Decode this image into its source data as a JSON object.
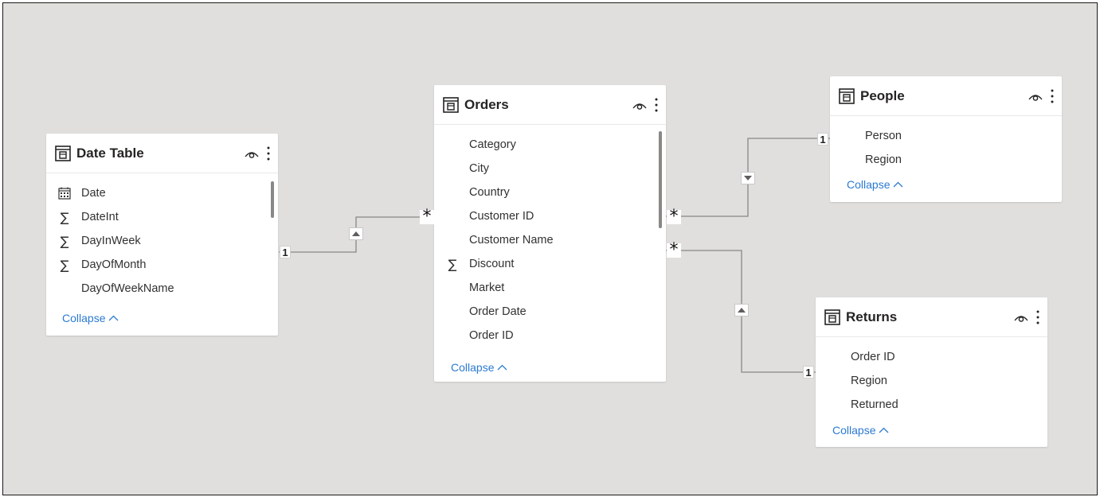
{
  "tables": {
    "date_table": {
      "title": "Date Table",
      "fields": [
        {
          "name": "Date",
          "icon": "calendar-icon"
        },
        {
          "name": "DateInt",
          "icon": "sigma-icon"
        },
        {
          "name": "DayInWeek",
          "icon": "sigma-icon"
        },
        {
          "name": "DayOfMonth",
          "icon": "sigma-icon"
        },
        {
          "name": "DayOfWeekName",
          "icon": ""
        }
      ],
      "collapse_label": "Collapse"
    },
    "orders": {
      "title": "Orders",
      "fields": [
        {
          "name": "Category",
          "icon": ""
        },
        {
          "name": "City",
          "icon": ""
        },
        {
          "name": "Country",
          "icon": ""
        },
        {
          "name": "Customer ID",
          "icon": ""
        },
        {
          "name": "Customer Name",
          "icon": ""
        },
        {
          "name": "Discount",
          "icon": "sigma-icon"
        },
        {
          "name": "Market",
          "icon": ""
        },
        {
          "name": "Order Date",
          "icon": ""
        },
        {
          "name": "Order ID",
          "icon": ""
        }
      ],
      "collapse_label": "Collapse"
    },
    "people": {
      "title": "People",
      "fields": [
        {
          "name": "Person",
          "icon": ""
        },
        {
          "name": "Region",
          "icon": ""
        }
      ],
      "collapse_label": "Collapse"
    },
    "returns": {
      "title": "Returns",
      "fields": [
        {
          "name": "Order ID",
          "icon": ""
        },
        {
          "name": "Region",
          "icon": ""
        },
        {
          "name": "Returned",
          "icon": ""
        }
      ],
      "collapse_label": "Collapse"
    }
  },
  "relationships": [
    {
      "from": "Date Table",
      "to": "Orders",
      "one_label": "1",
      "many_label": "*",
      "direction": "up"
    },
    {
      "from": "People",
      "to": "Orders",
      "one_label": "1",
      "many_label": "*",
      "direction": "down"
    },
    {
      "from": "Returns",
      "to": "Orders",
      "one_label": "1",
      "many_label": "*",
      "direction": "up"
    }
  ],
  "colors": {
    "canvas": "#e1dfdd",
    "card": "#ffffff",
    "link": "#2b7ad1",
    "line": "#8a8886"
  }
}
